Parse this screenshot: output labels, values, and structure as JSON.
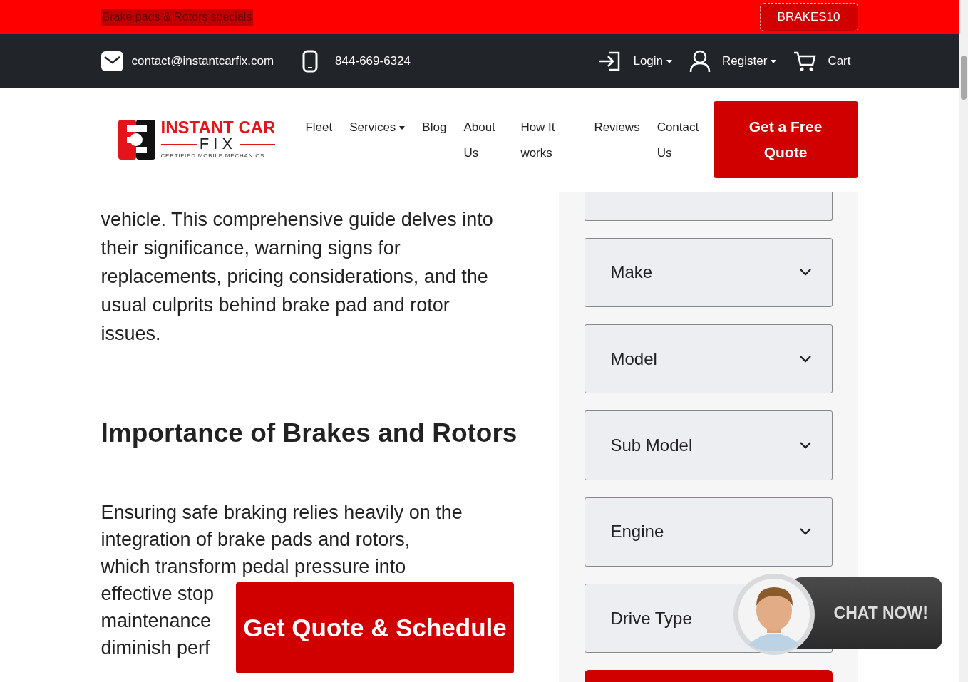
{
  "promo": {
    "text": "Brake pads & Rotors specials",
    "code": "BRAKES10"
  },
  "contact_bar": {
    "email": "contact@instantcarfix.com",
    "phone": "844-669-6324",
    "links": [
      {
        "kind": "login",
        "label": "Login",
        "dropdown": true
      },
      {
        "kind": "register",
        "label": "Register",
        "dropdown": true
      },
      {
        "kind": "cart",
        "label": "Cart",
        "dropdown": false
      }
    ]
  },
  "nav": {
    "logo": {
      "title": "INSTANT CAR",
      "subtitle": "FIX",
      "tagline": "CERTIFIED MOBILE MECHANICS"
    },
    "items": [
      {
        "label": "Fleet",
        "dropdown": false
      },
      {
        "label": "Services",
        "dropdown": true
      },
      {
        "label": "Blog",
        "dropdown": false
      },
      {
        "label": "About Us",
        "dropdown": false
      },
      {
        "label": "How It works",
        "dropdown": false
      },
      {
        "label": "Reviews",
        "dropdown": false
      },
      {
        "label": "Contact Us",
        "dropdown": false
      }
    ],
    "cta": "Get a Free Quote"
  },
  "article": {
    "intro": "vehicle. This comprehensive guide delves into their significance, warning signs for replacements, pricing considerations, and the usual culprits behind brake pad and rotor issues.",
    "heading": "Importance of Brakes and Rotors",
    "body_lines": [
      "Ensuring safe braking relies heavily on the",
      "integration of brake pads and rotors,",
      "which transform pedal pressure into",
      "effective stop",
      "maintenance",
      "diminish perf"
    ]
  },
  "sidebar": {
    "selects": [
      {
        "placeholder": "Make"
      },
      {
        "placeholder": "Model"
      },
      {
        "placeholder": "Sub Model"
      },
      {
        "placeholder": "Engine"
      },
      {
        "placeholder": "Drive Type"
      }
    ]
  },
  "floating_button": "Get Quote & Schedule",
  "chat": {
    "label": "CHAT NOW!"
  }
}
